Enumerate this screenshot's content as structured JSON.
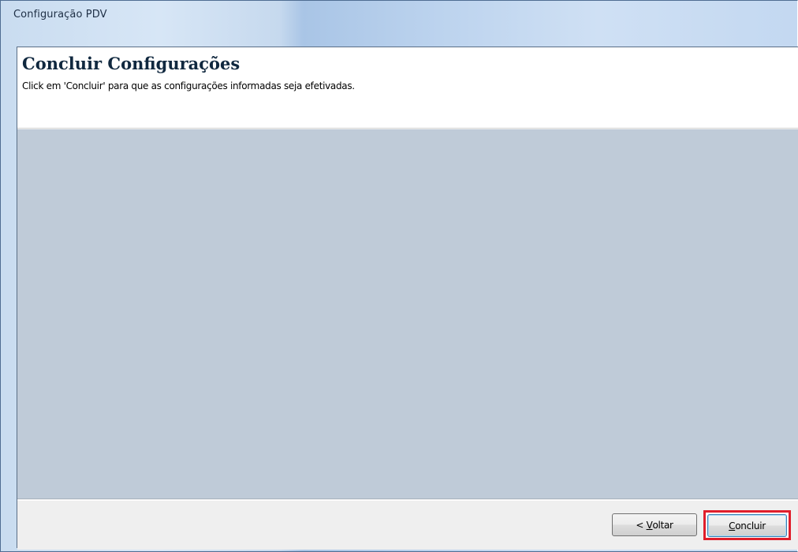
{
  "window": {
    "title": "Configuração PDV"
  },
  "header": {
    "title": "Concluir Configurações",
    "subtitle": "Click em 'Concluir' para que as configurações informadas seja efetivadas."
  },
  "footer": {
    "back_button": {
      "prefix": "< ",
      "mnemonic": "V",
      "rest": "oltar"
    },
    "finish_button": {
      "mnemonic": "C",
      "rest": "oncluir",
      "highlight_color": "#e01e2b"
    }
  }
}
